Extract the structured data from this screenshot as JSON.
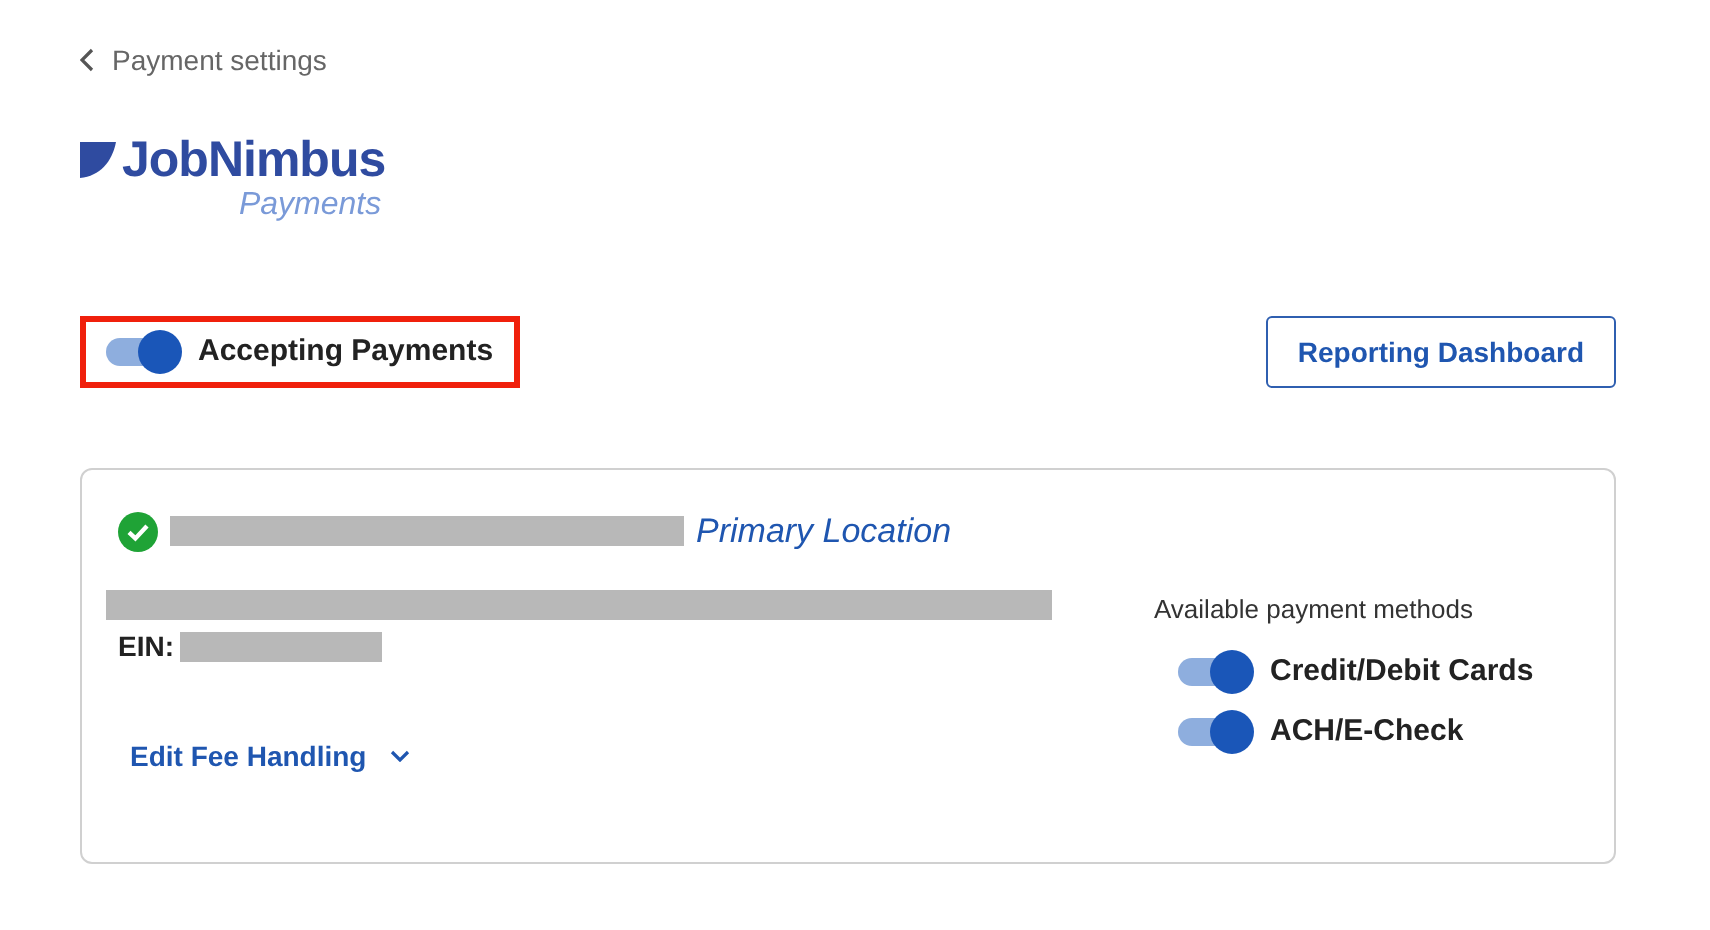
{
  "back_link": {
    "label": "Payment settings"
  },
  "logo": {
    "name": "JobNimbus",
    "subtitle": "Payments"
  },
  "accepting": {
    "label": "Accepting Payments",
    "on": true,
    "highlighted": true
  },
  "reporting_button": {
    "label": "Reporting Dashboard"
  },
  "location": {
    "verified": true,
    "tag": "Primary Location",
    "ein_label": "EIN:",
    "fee_link": "Edit Fee Handling",
    "methods_title": "Available payment methods",
    "methods": [
      {
        "label": "Credit/Debit Cards",
        "on": true
      },
      {
        "label": "ACH/E-Check",
        "on": true
      }
    ]
  }
}
